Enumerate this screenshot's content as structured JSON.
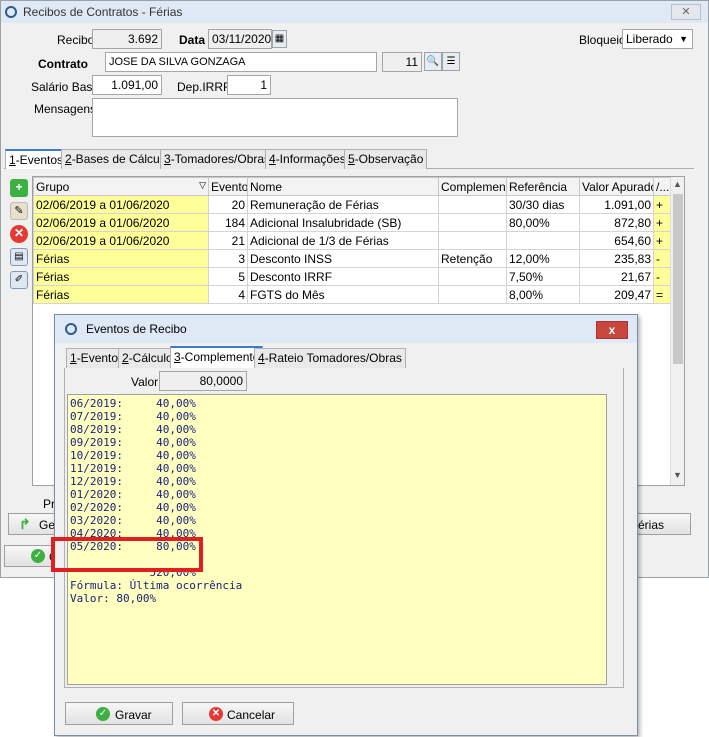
{
  "main": {
    "title": "Recibos de Contratos - Férias",
    "recibo_label": "Recibo",
    "recibo_value": "3.692",
    "data_label": "Data",
    "data_value": "03/11/2020",
    "bloqueio_label": "Bloqueio",
    "bloqueio_value": "Liberado",
    "contrato_label": "Contrato",
    "contrato_value": "JOSE DA SILVA GONZAGA",
    "contrato_num": "11",
    "salario_label": "Salário Base",
    "salario_value": "1.091,00",
    "dep_label": "Dep.IRRF",
    "dep_value": "1",
    "mensagens_label": "Mensagens",
    "mensagens_value": ""
  },
  "tabs": [
    {
      "key": "1",
      "label": "-Eventos"
    },
    {
      "key": "2",
      "label": "-Bases de Cálculo"
    },
    {
      "key": "3",
      "label": "-Tomadores/Obras"
    },
    {
      "key": "4",
      "label": "-Informações"
    },
    {
      "key": "5",
      "label": "-Observação"
    }
  ],
  "grid": {
    "headers": [
      "Grupo",
      "Evento",
      "Nome",
      "Complemento",
      "Referência",
      "Valor Apurado",
      "/..."
    ],
    "rows": [
      [
        "02/06/2019 a 01/06/2020",
        "20",
        "Remuneração de Férias",
        "",
        "30/30 dias",
        "1.091,00",
        "+"
      ],
      [
        "02/06/2019 a 01/06/2020",
        "184",
        "Adicional Insalubridade (SB)",
        "",
        "80,00%",
        "872,80",
        "+"
      ],
      [
        "02/06/2019 a 01/06/2020",
        "21",
        "Adicional de 1/3 de Férias",
        "",
        "",
        "654,60",
        "+"
      ],
      [
        "Férias",
        "3",
        "Desconto INSS",
        "Retenção",
        "12,00%",
        "235,83",
        "-"
      ],
      [
        "Férias",
        "5",
        "Desconto IRRF",
        "",
        "7,50%",
        "21,67",
        "-"
      ],
      [
        "Férias",
        "4",
        "FGTS do Mês",
        "",
        "8,00%",
        "209,47",
        "="
      ]
    ]
  },
  "bottom": {
    "pr_label": "Pr",
    "gen_label": "Ger",
    "ferias_label": "érias",
    "ok_label": "O"
  },
  "dialog": {
    "title": "Eventos de Recibo",
    "close": "x",
    "tabs": [
      {
        "key": "1",
        "label": "-Evento"
      },
      {
        "key": "2",
        "label": "-Cálculo"
      },
      {
        "key": "3",
        "label": "-Complemento"
      },
      {
        "key": "4",
        "label": "-Rateio Tomadores/Obras"
      }
    ],
    "valor_label": "Valor",
    "valor_value": "80,0000",
    "memo_lines": [
      "06/2019:     40,00%",
      "07/2019:     40,00%",
      "08/2019:     40,00%",
      "09/2019:     40,00%",
      "10/2019:     40,00%",
      "11/2019:     40,00%",
      "12/2019:     40,00%",
      "01/2020:     40,00%",
      "02/2020:     40,00%",
      "03/2020:     40,00%",
      "04/2020:     40,00%",
      "05/2020:     80,00%",
      "",
      "            520,00%",
      "Fórmula: Última ocorrência",
      "Valor: 80,00%"
    ],
    "gravar_label": "Gravar",
    "cancelar_label": "Cancelar"
  },
  "colors": {
    "highlight": "#e02020",
    "memo_bg": "#ffffc0",
    "grid_yellow": "#ffff99",
    "tab_accent": "#3a7bd5"
  }
}
